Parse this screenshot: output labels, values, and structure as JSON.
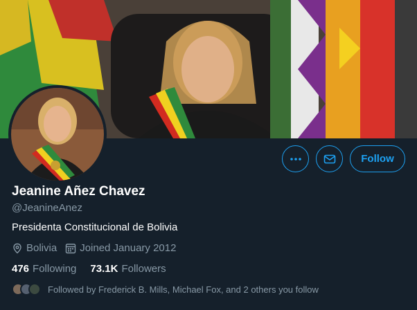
{
  "profile": {
    "name": "Jeanine Añez Chavez",
    "handle": "@JeanineAnez",
    "bio": "Presidenta Constitucional de Bolivia",
    "location": "Bolivia",
    "joined": "Joined January 2012"
  },
  "stats": {
    "following_count": "476",
    "following_label": "Following",
    "followers_count": "73.1K",
    "followers_label": "Followers"
  },
  "followed_by": {
    "text": "Followed by Frederick B. Mills, Michael Fox, and 2 others you follow"
  },
  "actions": {
    "more_icon": "more-icon",
    "message_icon": "envelope-icon",
    "follow_label": "Follow"
  },
  "colors": {
    "background": "#15202b",
    "accent": "#1da1f2",
    "secondary_text": "#8899a6"
  }
}
